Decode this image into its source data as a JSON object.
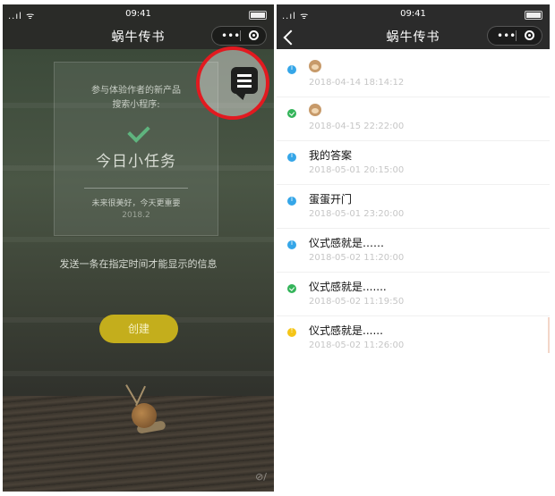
{
  "left": {
    "statusbar": {
      "signal": "..ıl ᯤ",
      "time": "09:41"
    },
    "navbar": {
      "title": "蜗牛传书",
      "more": "•••"
    },
    "card": {
      "line1": "参与体验作者的新产品",
      "line2": "搜索小程序:",
      "title": "今日小任务",
      "line3": "未来很美好，今天更重要",
      "date": "2018.2"
    },
    "message": "发送一条在指定时间才能显示的信息",
    "create_button": "创建",
    "share_glyph": "⊘/"
  },
  "right": {
    "statusbar": {
      "signal": "..ıl ᯤ",
      "time": "09:41"
    },
    "navbar": {
      "title": "蜗牛传书",
      "more": "•••"
    },
    "items": [
      {
        "status": "info",
        "title": "",
        "timestamp": "2018-04-14 18:14:12",
        "icon": "monkey-emoji-icon"
      },
      {
        "status": "ok",
        "title": "",
        "timestamp": "2018-04-15 22:22:00",
        "icon": "monkey-emoji-icon"
      },
      {
        "status": "info",
        "title": "我的答案",
        "timestamp": "2018-05-01 20:15:00"
      },
      {
        "status": "info",
        "title": "蛋蛋开门",
        "timestamp": "2018-05-01 23:20:00"
      },
      {
        "status": "info",
        "title": "仪式感就是……",
        "timestamp": "2018-05-02 11:20:00"
      },
      {
        "status": "ok",
        "title": "仪式感就是.......",
        "timestamp": "2018-05-02 11:19:50"
      },
      {
        "status": "warn",
        "title": "仪式感就是......",
        "timestamp": "2018-05-02 11:26:00"
      }
    ]
  },
  "colors": {
    "info": "#35a6e8",
    "ok": "#34b45a",
    "warn": "#f5c518",
    "button": "#c4ae1c",
    "highlight_ring": "#e21a20"
  }
}
